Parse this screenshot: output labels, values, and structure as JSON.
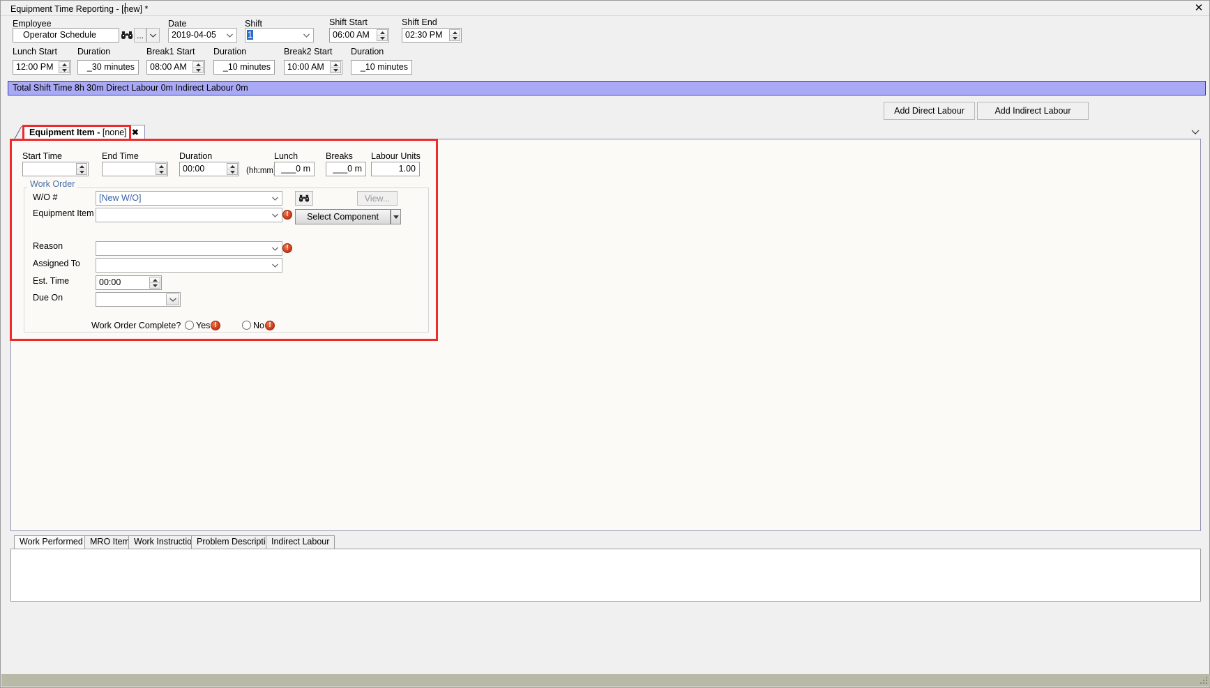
{
  "window": {
    "document_tab_title": "Equipment Time Reporting - [new] *",
    "close_icon": "close-icon",
    "close_glyph": "✕"
  },
  "header": {
    "employee": {
      "label": "Employee",
      "value": "Operator Schedule",
      "browse_icon": "binoculars-icon",
      "ellipsis_label": "...",
      "dropdown_icon": "chevron-down-icon"
    },
    "date": {
      "label": "Date",
      "value": "2019-04-05"
    },
    "shift": {
      "label": "Shift",
      "value": "1"
    },
    "shift_start": {
      "label": "Shift Start",
      "value": "06:00 AM"
    },
    "shift_end": {
      "label": "Shift End",
      "value": "02:30 PM"
    },
    "lunch_start": {
      "label": "Lunch Start",
      "value": "12:00 PM"
    },
    "lunch_duration": {
      "label": "Duration",
      "value": "_30 minutes"
    },
    "break1_start": {
      "label": "Break1 Start",
      "value": "08:00 AM"
    },
    "break1_duration": {
      "label": "Duration",
      "value": "_10 minutes"
    },
    "break2_start": {
      "label": "Break2 Start",
      "value": "10:00 AM"
    },
    "break2_duration": {
      "label": "Duration",
      "value": "_10 minutes"
    }
  },
  "total_bar": {
    "text": "Total Shift Time 8h 30m  Direct Labour 0m  Indirect Labour 0m",
    "background": "#a9a9f5",
    "border": "#3a3ac0"
  },
  "labour_buttons": {
    "add_direct": "Add Direct Labour",
    "add_indirect": "Add Indirect Labour"
  },
  "equipment_tab": {
    "title_prefix": "Equipment Item - ",
    "title_value": "[none]",
    "close_glyph": "✖",
    "overflow_icon": "chevron-down-icon"
  },
  "time_row": {
    "start_time": {
      "label": "Start Time",
      "value": ""
    },
    "end_time": {
      "label": "End Time",
      "value": ""
    },
    "duration": {
      "label": "Duration",
      "value": "00:00",
      "hint": "(hh:mm)"
    },
    "lunch": {
      "label": "Lunch",
      "value": "___0 m"
    },
    "breaks": {
      "label": "Breaks",
      "value": "___0 m"
    },
    "labour_units": {
      "label": "Labour Units",
      "value": "1.00"
    }
  },
  "work_order": {
    "group_label": "Work Order",
    "wo_number": {
      "label": "W/O #",
      "value": "[New W/O]"
    },
    "search_icon": "binoculars-icon",
    "view_button": "View...",
    "equipment_item": {
      "label": "Equipment Item",
      "value": ""
    },
    "select_component_button": "Select Component",
    "reason": {
      "label": "Reason",
      "value": ""
    },
    "assigned_to": {
      "label": "Assigned To",
      "value": ""
    },
    "est_time": {
      "label": "Est. Time",
      "value": "00:00"
    },
    "due_on": {
      "label": "Due On",
      "value": ""
    },
    "complete": {
      "label": "Work Order Complete?",
      "yes_label": "Yes",
      "no_label": "No"
    }
  },
  "bottom_tabs": [
    {
      "label": "Work Performed",
      "active": true
    },
    {
      "label": "MRO Items",
      "active": false
    },
    {
      "label": "Work Instructions",
      "active": false
    },
    {
      "label": "Problem Description",
      "active": false
    },
    {
      "label": "Indirect Labour",
      "active": false
    }
  ],
  "annotation": {
    "color": "#ee2b2b"
  }
}
